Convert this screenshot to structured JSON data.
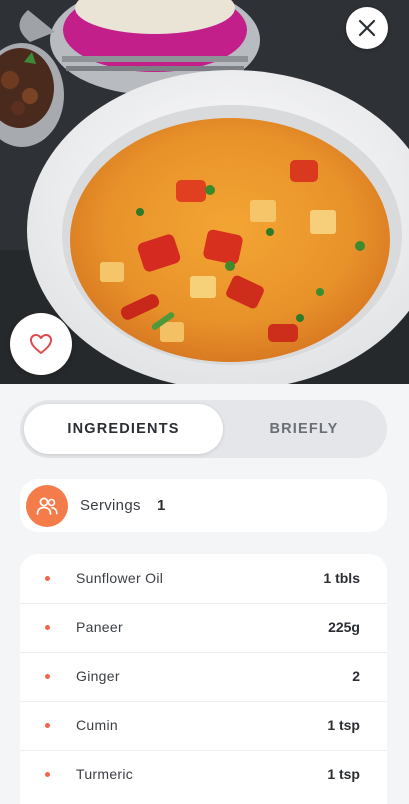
{
  "hero": {
    "image": "curry-bowl-photo"
  },
  "actions": {
    "close_icon": "close-icon",
    "favorite_icon": "heart-icon"
  },
  "tabs": [
    {
      "label": "INGREDIENTS",
      "active": true
    },
    {
      "label": "BRIEFLY",
      "active": false
    }
  ],
  "servings": {
    "label": "Servings",
    "value": "1",
    "icon": "people-icon"
  },
  "ingredients": [
    {
      "name": "Sunflower Oil",
      "qty": "1 tbls"
    },
    {
      "name": "Paneer",
      "qty": "225g"
    },
    {
      "name": "Ginger",
      "qty": "2"
    },
    {
      "name": "Cumin",
      "qty": "1 tsp"
    },
    {
      "name": "Turmeric",
      "qty": "1 tsp"
    }
  ],
  "colors": {
    "accent": "#f47c4a",
    "bullet": "#f0664d",
    "background": "#f4f5f7",
    "tab_track": "#e4e6e9"
  }
}
